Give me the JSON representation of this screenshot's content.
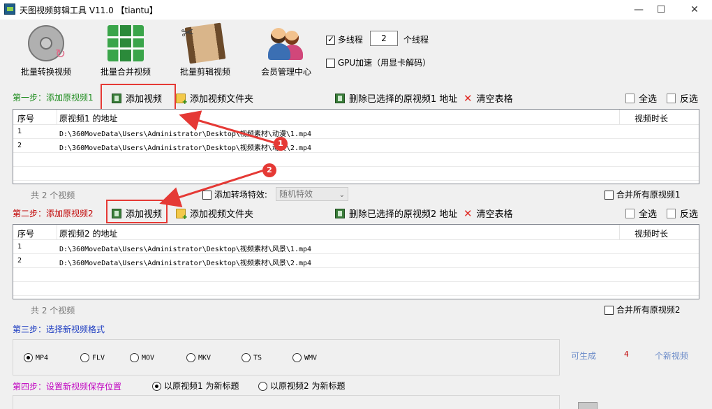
{
  "window": {
    "title": "天图视频剪辑工具 V11.0  【tiantu】",
    "minimize": "—",
    "maximize": "☐",
    "close": "✕"
  },
  "toolbar": {
    "batch_convert": "批量转换视频",
    "batch_merge": "批量合并视频",
    "batch_cut": "批量剪辑视频",
    "member": "会员管理中心"
  },
  "options": {
    "multithread_label": "多线程",
    "multithread_checked": true,
    "thread_count": "2",
    "thread_unit": "个线程",
    "gpu_label": "GPU加速（用显卡解码）",
    "gpu_checked": false
  },
  "step1": {
    "title": "第一步：添加原视频1",
    "add_video": "添加视频",
    "add_folder": "添加视频文件夹",
    "delete_selected": "删除已选择的原视频1 地址",
    "clear_table": "清空表格",
    "select_all": "全选",
    "invert": "反选",
    "table": {
      "col_index": "序号",
      "col_path": "原视频1 的地址",
      "col_duration": "视频时长",
      "rows": [
        {
          "index": "1",
          "path": "D:\\360MoveData\\Users\\Administrator\\Desktop\\视频素材\\动漫\\1.mp4",
          "duration": ""
        },
        {
          "index": "2",
          "path": "D:\\360MoveData\\Users\\Administrator\\Desktop\\视频素材\\动漫\\2.mp4",
          "duration": ""
        }
      ]
    },
    "count": "共 2 个视频",
    "transition_label": "添加转场特效:",
    "transition_value": "随机特效",
    "merge_all": "合并所有原视频1"
  },
  "step2": {
    "title": "第二步：添加原视频2",
    "add_video": "添加视频",
    "add_folder": "添加视频文件夹",
    "delete_selected": "删除已选择的原视频2 地址",
    "clear_table": "清空表格",
    "select_all": "全选",
    "invert": "反选",
    "table": {
      "col_index": "序号",
      "col_path": "原视频2 的地址",
      "col_duration": "视频时长",
      "rows": [
        {
          "index": "1",
          "path": "D:\\360MoveData\\Users\\Administrator\\Desktop\\视频素材\\风景\\1.mp4",
          "duration": ""
        },
        {
          "index": "2",
          "path": "D:\\360MoveData\\Users\\Administrator\\Desktop\\视频素材\\风景\\2.mp4",
          "duration": ""
        }
      ]
    },
    "count": "共 2 个视频",
    "merge_all": "合并所有原视频2"
  },
  "step3": {
    "title": "第三步：选择新视频格式",
    "formats": [
      "MP4",
      "FLV",
      "MOV",
      "MKV",
      "TS",
      "WMV"
    ],
    "selected_format": "MP4",
    "can_generate": "可生成",
    "generate_count": "4",
    "generate_unit": "个新视频"
  },
  "step4": {
    "title": "第四步：设置新视频保存位置",
    "opt_title1": "以原视频1 为新标题",
    "opt_title2": "以原视频2 为新标题",
    "selected": "以原视频1 为新标题"
  },
  "annotations": {
    "badge1": "1",
    "badge2": "2",
    "color": "#e53935"
  }
}
